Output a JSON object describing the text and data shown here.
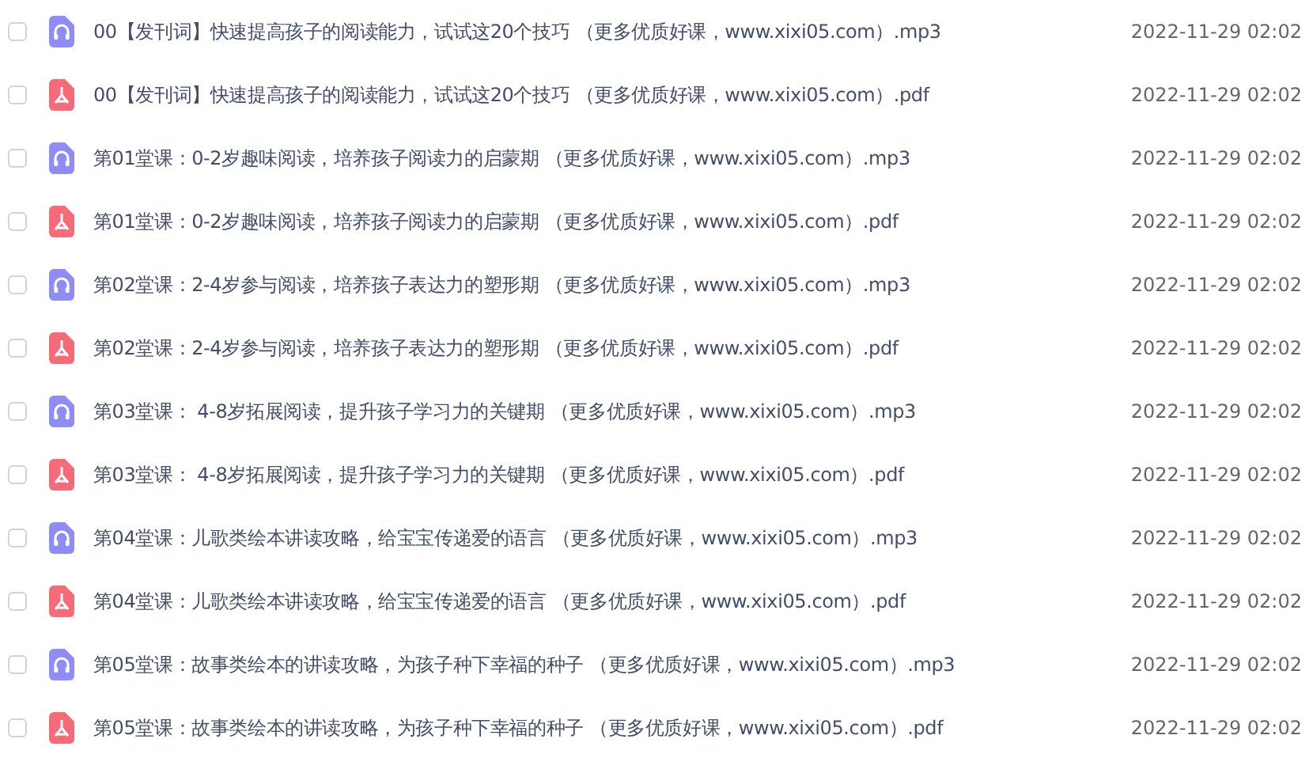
{
  "files": [
    {
      "kind": "audio",
      "checked": false,
      "name": "00【发刊词】快速提高孩子的阅读能力，试试这20个技巧 （更多优质好课，www.xixi05.com）.mp3",
      "modified": "2022-11-29 02:02"
    },
    {
      "kind": "pdf",
      "checked": false,
      "name": "00【发刊词】快速提高孩子的阅读能力，试试这20个技巧 （更多优质好课，www.xixi05.com）.pdf",
      "modified": "2022-11-29 02:02"
    },
    {
      "kind": "audio",
      "checked": false,
      "name": "第01堂课：0-2岁趣味阅读，培养孩子阅读力的启蒙期 （更多优质好课，www.xixi05.com）.mp3",
      "modified": "2022-11-29 02:02"
    },
    {
      "kind": "pdf",
      "checked": false,
      "name": "第01堂课：0-2岁趣味阅读，培养孩子阅读力的启蒙期 （更多优质好课，www.xixi05.com）.pdf",
      "modified": "2022-11-29 02:02"
    },
    {
      "kind": "audio",
      "checked": false,
      "name": "第02堂课：2-4岁参与阅读，培养孩子表达力的塑形期 （更多优质好课，www.xixi05.com）.mp3",
      "modified": "2022-11-29 02:02"
    },
    {
      "kind": "pdf",
      "checked": false,
      "name": "第02堂课：2-4岁参与阅读，培养孩子表达力的塑形期 （更多优质好课，www.xixi05.com）.pdf",
      "modified": "2022-11-29 02:02"
    },
    {
      "kind": "audio",
      "checked": false,
      "name": "第03堂课： 4-8岁拓展阅读，提升孩子学习力的关键期 （更多优质好课，www.xixi05.com）.mp3",
      "modified": "2022-11-29 02:02"
    },
    {
      "kind": "pdf",
      "checked": false,
      "name": "第03堂课： 4-8岁拓展阅读，提升孩子学习力的关键期 （更多优质好课，www.xixi05.com）.pdf",
      "modified": "2022-11-29 02:02"
    },
    {
      "kind": "audio",
      "checked": false,
      "name": "第04堂课：儿歌类绘本讲读攻略，给宝宝传递爱的语言 （更多优质好课，www.xixi05.com）.mp3",
      "modified": "2022-11-29 02:02"
    },
    {
      "kind": "pdf",
      "checked": false,
      "name": "第04堂课：儿歌类绘本讲读攻略，给宝宝传递爱的语言 （更多优质好课，www.xixi05.com）.pdf",
      "modified": "2022-11-29 02:02"
    },
    {
      "kind": "audio",
      "checked": false,
      "name": "第05堂课：故事类绘本的讲读攻略，为孩子种下幸福的种子 （更多优质好课，www.xixi05.com）.mp3",
      "modified": "2022-11-29 02:02"
    },
    {
      "kind": "pdf",
      "checked": false,
      "name": "第05堂课：故事类绘本的讲读攻略，为孩子种下幸福的种子 （更多优质好课，www.xixi05.com）.pdf",
      "modified": "2022-11-29 02:02"
    }
  ]
}
